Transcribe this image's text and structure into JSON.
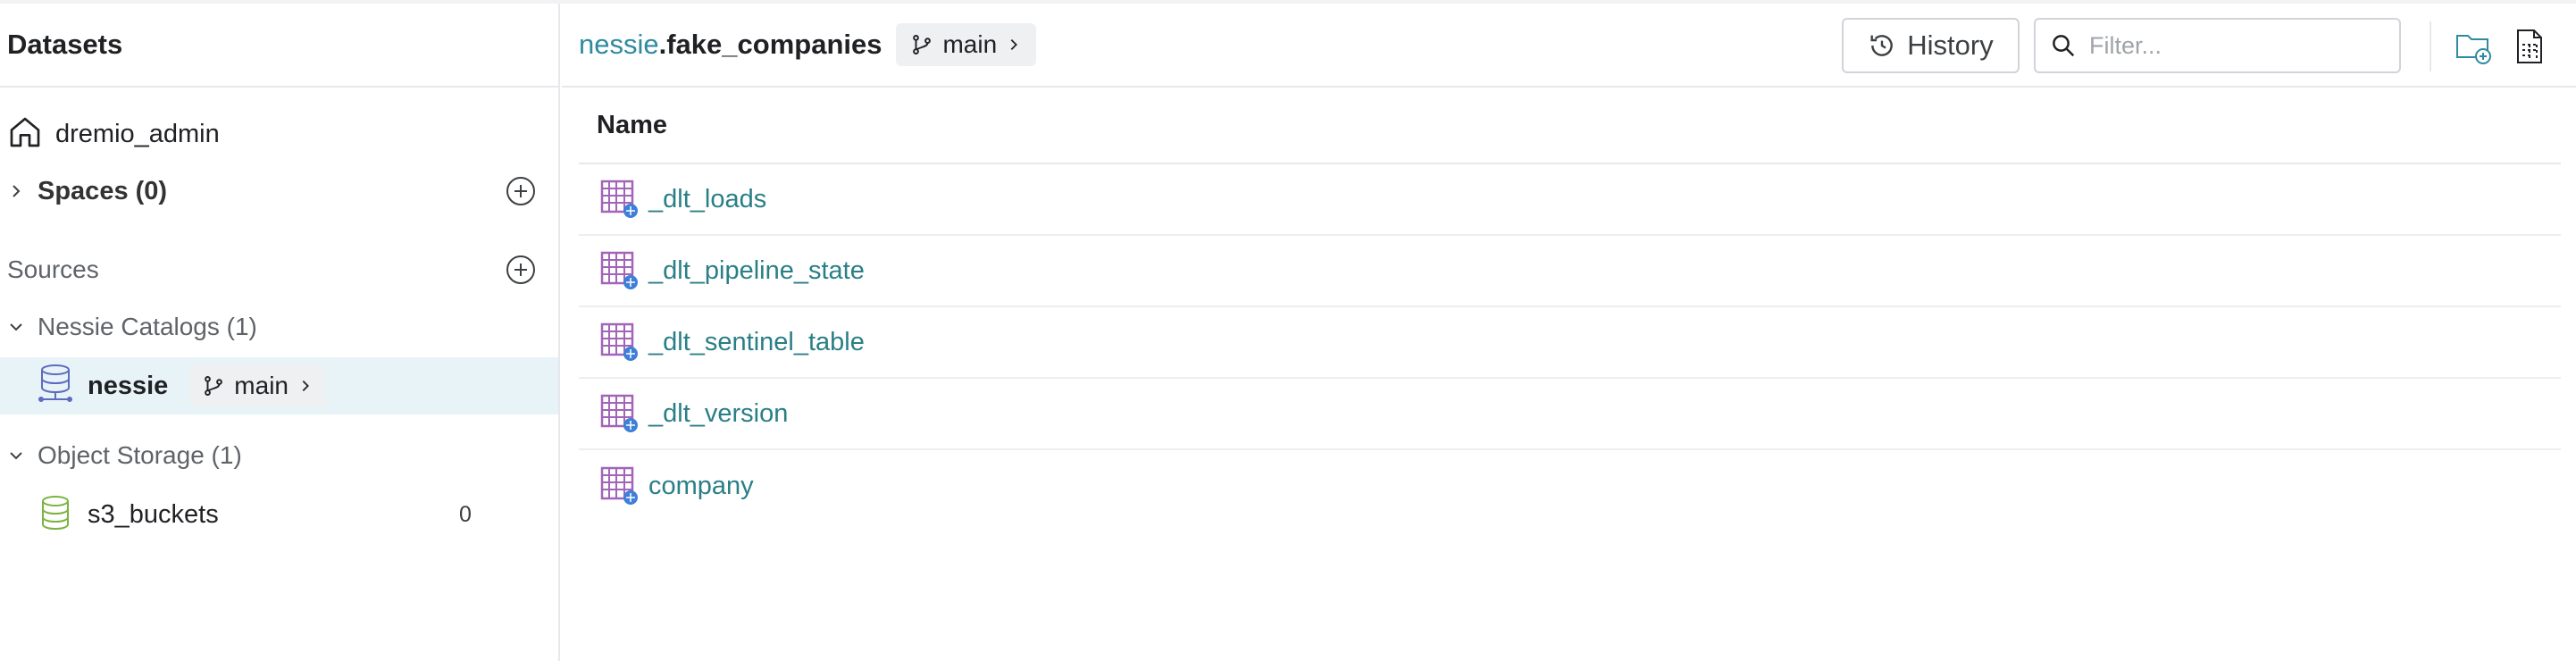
{
  "sidebar": {
    "title": "Datasets",
    "home": {
      "label": "dremio_admin",
      "icon": "home-icon"
    },
    "spaces": {
      "label": "Spaces (0)"
    },
    "sources": {
      "label": "Sources",
      "groups": [
        {
          "label": "Nessie Catalogs (1)",
          "items": [
            {
              "label": "nessie",
              "branch": "main",
              "icon": "nessie-database-icon"
            }
          ]
        },
        {
          "label": "Object Storage (1)",
          "items": [
            {
              "label": "s3_buckets",
              "count": "0",
              "icon": "s3-database-icon"
            }
          ]
        }
      ]
    }
  },
  "header": {
    "breadcrumb_source": "nessie",
    "breadcrumb_sep": ".",
    "breadcrumb_name": "fake_companies",
    "branch": "main",
    "history_label": "History",
    "filter_placeholder": "Filter..."
  },
  "table": {
    "column_name": "Name",
    "rows": [
      {
        "name": "_dlt_loads"
      },
      {
        "name": "_dlt_pipeline_state"
      },
      {
        "name": "_dlt_sentinel_table"
      },
      {
        "name": "_dlt_version"
      },
      {
        "name": "company"
      }
    ]
  },
  "colors": {
    "accent_teal": "#2a7f86",
    "breadcrumb_link": "#2f8aa0",
    "selected_bg": "#e8f3f7",
    "table_icon": "#a264b8",
    "s3_icon": "#7cb342",
    "nessie_icon": "#5c6bc0"
  }
}
